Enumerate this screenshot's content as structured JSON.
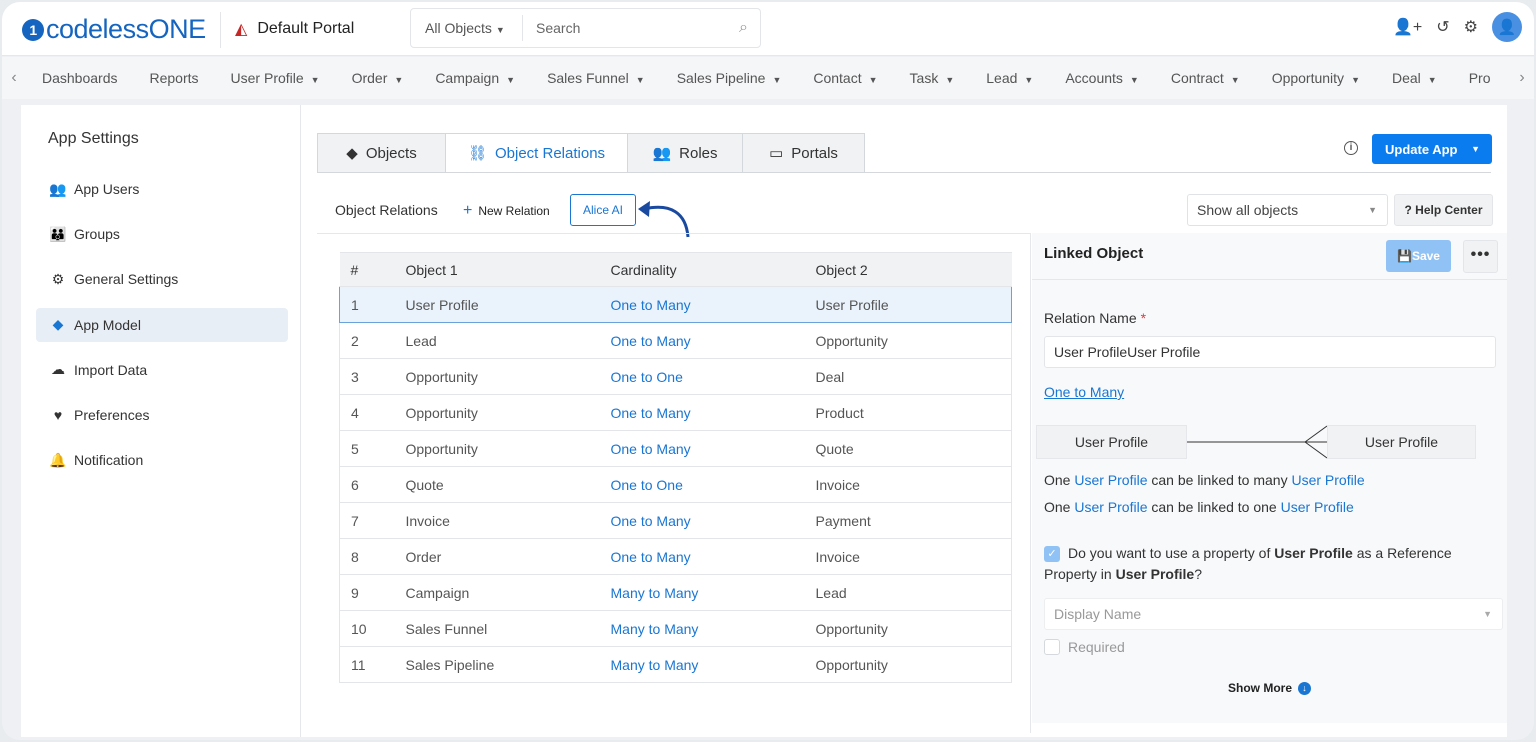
{
  "header": {
    "logo": "codelessONE",
    "portal": "Default Portal",
    "search_scope": "All Objects",
    "search_placeholder": "Search"
  },
  "nav": [
    "Dashboards",
    "Reports",
    "User Profile",
    "Order",
    "Campaign",
    "Sales Funnel",
    "Sales Pipeline",
    "Contact",
    "Task",
    "Lead",
    "Accounts",
    "Contract",
    "Opportunity",
    "Deal",
    "Pro"
  ],
  "nav_dropdown": [
    false,
    false,
    true,
    true,
    true,
    true,
    true,
    true,
    true,
    true,
    true,
    true,
    true,
    true,
    false
  ],
  "sidebar": {
    "title": "App Settings",
    "items": [
      {
        "label": "App Users",
        "icon": "users-icon",
        "glyph": "👥"
      },
      {
        "label": "Groups",
        "icon": "group-icon",
        "glyph": "👪"
      },
      {
        "label": "General Settings",
        "icon": "gear-icon",
        "glyph": "⚙"
      },
      {
        "label": "App Model",
        "icon": "cube-icon",
        "glyph": "◆",
        "active": true
      },
      {
        "label": "Import Data",
        "icon": "cloud-upload-icon",
        "glyph": "☁"
      },
      {
        "label": "Preferences",
        "icon": "hand-heart-icon",
        "glyph": "♥"
      },
      {
        "label": "Notification",
        "icon": "bell-icon",
        "glyph": "🔔"
      }
    ]
  },
  "tabs": [
    {
      "label": "Objects",
      "glyph": "◆"
    },
    {
      "label": "Object Relations",
      "glyph": "⛓"
    },
    {
      "label": "Roles",
      "glyph": "👥"
    },
    {
      "label": "Portals",
      "glyph": "▭"
    }
  ],
  "update_app": "Update App",
  "toolbar": {
    "title": "Object Relations",
    "new_relation": "New Relation",
    "alice": "Alice AI",
    "filter": "Show all objects",
    "help": "? Help Center"
  },
  "table": {
    "headers": [
      "#",
      "Object 1",
      "Cardinality",
      "Object 2"
    ],
    "rows": [
      [
        "1",
        "User Profile",
        "One to Many",
        "User Profile"
      ],
      [
        "2",
        "Lead",
        "One to Many",
        "Opportunity"
      ],
      [
        "3",
        "Opportunity",
        "One to One",
        "Deal"
      ],
      [
        "4",
        "Opportunity",
        "One to Many",
        "Product"
      ],
      [
        "5",
        "Opportunity",
        "One to Many",
        "Quote"
      ],
      [
        "6",
        "Quote",
        "One to One",
        "Invoice"
      ],
      [
        "7",
        "Invoice",
        "One to Many",
        "Payment"
      ],
      [
        "8",
        "Order",
        "One to Many",
        "Invoice"
      ],
      [
        "9",
        "Campaign",
        "Many to Many",
        "Lead"
      ],
      [
        "10",
        "Sales Funnel",
        "Many to Many",
        "Opportunity"
      ],
      [
        "11",
        "Sales Pipeline",
        "Many to Many",
        "Opportunity"
      ]
    ]
  },
  "panel": {
    "title": "Linked Object",
    "save": "Save",
    "relation_label": "Relation Name",
    "relation_value": "User ProfileUser Profile",
    "cardinality": "One to Many",
    "obj_a": "User Profile",
    "obj_b": "User Profile",
    "s1": [
      "One ",
      "User Profile",
      " can be linked to many ",
      "User Profile"
    ],
    "s2": [
      "One ",
      "User Profile",
      " can be linked to one ",
      "User Profile"
    ],
    "q": [
      "Do you want to use a property of ",
      "User Profile",
      " as a Reference Property in ",
      "User Profile",
      "?"
    ],
    "ref_checked": true,
    "display_placeholder": "Display Name",
    "required": "Required",
    "show_more": "Show More"
  },
  "colors": {
    "accent": "#0a7cf0",
    "link": "#1976d2"
  }
}
